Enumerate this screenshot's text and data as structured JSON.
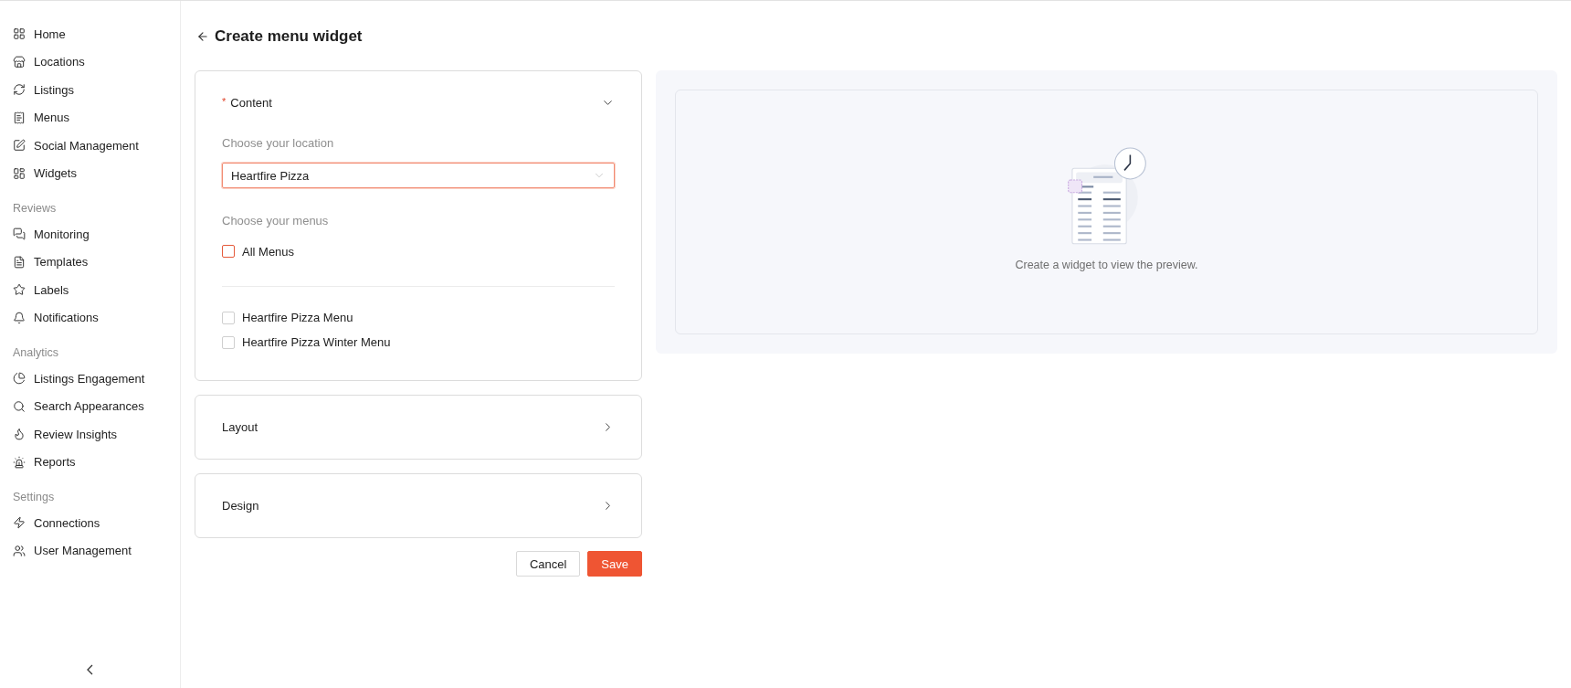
{
  "sidebar": {
    "sections": [
      {
        "items": [
          {
            "label": "Home"
          },
          {
            "label": "Locations"
          },
          {
            "label": "Listings"
          },
          {
            "label": "Menus"
          },
          {
            "label": "Social Management"
          },
          {
            "label": "Widgets"
          }
        ]
      },
      {
        "heading": "Reviews",
        "items": [
          {
            "label": "Monitoring"
          },
          {
            "label": "Templates"
          },
          {
            "label": "Labels"
          },
          {
            "label": "Notifications"
          }
        ]
      },
      {
        "heading": "Analytics",
        "items": [
          {
            "label": "Listings Engagement"
          },
          {
            "label": "Search Appearances"
          },
          {
            "label": "Review Insights"
          },
          {
            "label": "Reports"
          }
        ]
      },
      {
        "heading": "Settings",
        "items": [
          {
            "label": "Connections"
          },
          {
            "label": "User Management"
          }
        ]
      }
    ]
  },
  "page": {
    "title": "Create menu widget"
  },
  "sections": [
    {
      "title": "Content",
      "required_mark": "*",
      "expanded": true,
      "location": {
        "label": "Choose your location",
        "value": "Heartfire Pizza",
        "focused": true
      },
      "menus": {
        "label": "Choose your menus",
        "all": {
          "label": "All Menus",
          "checked": false,
          "highlighted": true
        },
        "items": [
          {
            "label": "Heartfire Pizza Menu",
            "checked": false
          },
          {
            "label": "Heartfire Pizza Winter Menu",
            "checked": false
          }
        ]
      }
    },
    {
      "title": "Layout",
      "expanded": false
    },
    {
      "title": "Design",
      "expanded": false
    }
  ],
  "actions": {
    "cancel": "Cancel",
    "save": "Save"
  },
  "preview": {
    "message": "Create a widget to view the preview."
  }
}
